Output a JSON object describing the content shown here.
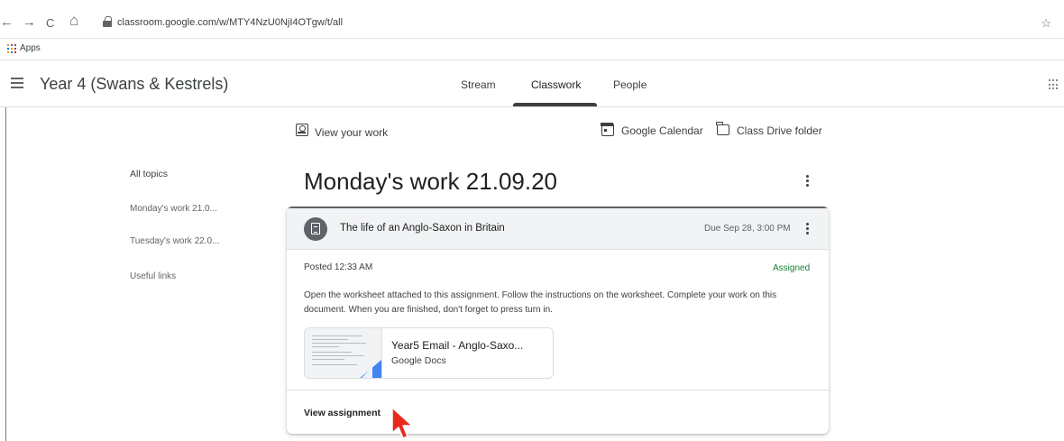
{
  "browser": {
    "url": "classroom.google.com/w/MTY4NzU0NjI4OTgw/t/all",
    "nav": {
      "back": "←",
      "forward": "→",
      "reload": "C",
      "home": "⌂"
    },
    "bookmarks": {
      "apps_label": "Apps"
    }
  },
  "appbar": {
    "class_title": "Year 4 (Swans & Kestrels)",
    "tabs": [
      {
        "label": "Stream"
      },
      {
        "label": "Classwork"
      },
      {
        "label": "People"
      }
    ]
  },
  "actions": {
    "view_work": "View your work",
    "calendar": "Google Calendar",
    "drive": "Class Drive folder"
  },
  "topics": {
    "items": [
      {
        "label": "All topics"
      },
      {
        "label": "Monday's work 21.0..."
      },
      {
        "label": "Tuesday's work 22.0..."
      },
      {
        "label": "Useful links"
      }
    ]
  },
  "topic": {
    "title": "Monday's work 21.09.20"
  },
  "assignment": {
    "title": "The life of an Anglo-Saxon in Britain",
    "due": "Due Sep 28, 3:00 PM",
    "posted": "Posted 12:33 AM",
    "status": "Assigned",
    "instructions": "Open the worksheet attached to this assignment. Follow the instructions on the worksheet. Complete your work on this document. When you are finished, don't forget to press turn in.",
    "attachment": {
      "title": "Year5 Email - Anglo-Saxo...",
      "type": "Google Docs"
    },
    "footer_link": "View assignment"
  },
  "colors": {
    "status_assigned": "#188038",
    "card_border": "#5f6368",
    "cursor": "#e8291c"
  }
}
